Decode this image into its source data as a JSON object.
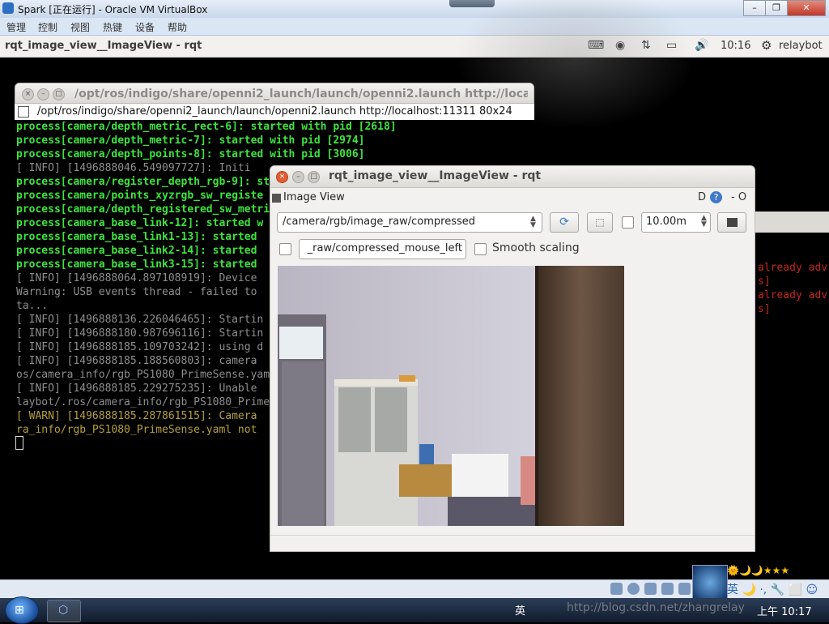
{
  "vbox": {
    "window_title": "Spark [正在运行] - Oracle VM VirtualBox",
    "menu": [
      "管理",
      "控制",
      "视图",
      "热键",
      "设备",
      "帮助"
    ],
    "controls": {
      "minimize": "–",
      "maximize": "❐",
      "close": "✕"
    }
  },
  "ubuntu_panel": {
    "app_title": "rqt_image_view__ImageView - rqt",
    "time": "10:16",
    "user": "relaybot",
    "icons": [
      "keyboard-icon",
      "chrome-icon",
      "network-updown-icon",
      "battery-icon",
      "volume-icon",
      "gear-icon"
    ]
  },
  "terminal": {
    "window_title": "/opt/ros/indigo/share/openni2_launch/launch/openni2.launch http://localhost:",
    "tab_label": "/opt/ros/indigo/share/openni2_launch/launch/openni2.launch http://localhost:11311 80x24",
    "lines": [
      {
        "text": "process[camera/depth_metric_rect-6]: started with pid [2618]",
        "style": "green"
      },
      {
        "text": "process[camera/depth_metric-7]: started with pid [2974]",
        "style": "green"
      },
      {
        "text": "process[camera/depth_points-8]: started with pid [3006]",
        "style": "green"
      },
      {
        "text": "[ INFO] [1496888046.549097727]: Initi",
        "style": "dim"
      },
      {
        "text": "process[camera/register_depth_rgb-9]: st",
        "style": "green"
      },
      {
        "text": "process[camera/points_xyzrgb_sw_registe",
        "style": "green"
      },
      {
        "text": "process[camera/depth_registered_sw_metri",
        "style": "green"
      },
      {
        "text": "process[camera_base_link-12]: started w",
        "style": "green"
      },
      {
        "text": "process[camera_base_link1-13]: started",
        "style": "green"
      },
      {
        "text": "process[camera_base_link2-14]: started",
        "style": "green"
      },
      {
        "text": "process[camera_base_link3-15]: started",
        "style": "green"
      },
      {
        "text": "[ INFO] [1496888064.897108919]: Device",
        "style": "dim"
      },
      {
        "text": "Warning: USB events thread - failed to",
        "style": "dim"
      },
      {
        "text": "ta...",
        "style": "dim"
      },
      {
        "text": "[ INFO] [1496888136.226046465]: Startin",
        "style": "dim"
      },
      {
        "text": "[ INFO] [1496888180.987696116]: Startin",
        "style": "dim"
      },
      {
        "text": "[ INFO] [1496888185.109703242]: using d",
        "style": "dim"
      },
      {
        "text": "[ INFO] [1496888185.188560803]: camera",
        "style": "dim"
      },
      {
        "text": "os/camera_info/rgb_PS1080_PrimeSense.yam",
        "style": "dim"
      },
      {
        "text": "[ INFO] [1496888185.229275235]: Unable",
        "style": "dim"
      },
      {
        "text": "laybot/.ros/camera_info/rgb_PS1080_Prime",
        "style": "dim"
      },
      {
        "text": "[ WARN] [1496888185.287861515]: Camera",
        "style": "warn"
      },
      {
        "text": "ra_info/rgb_PS1080_PrimeSense.yaml not",
        "style": "warn"
      }
    ]
  },
  "bg_terminal": {
    "lines": [
      "already adv",
      "s]",
      "already adv",
      "s]"
    ]
  },
  "rqt": {
    "window_title": "rqt_image_view__ImageView - rqt",
    "plugin_label": "Image View",
    "plugin_controls": "D",
    "plugin_extra": "- O",
    "topic": "/camera/rgb/image_raw/compressed",
    "spin_value": "10.00m",
    "mouse_topic": "_raw/compressed_mouse_left",
    "smooth_scaling_label": "Smooth scaling",
    "smooth_scaling_checked": false,
    "option_checkbox_checked": false,
    "mouse_checkbox_checked": false
  },
  "ime": {
    "row1": "🌞🌙🌙★★★",
    "row2": "英 🌙 ·, 🔧 ⬜ ☺"
  },
  "taskbar": {
    "lang": "英",
    "tray": "▾ 🛡 🔊",
    "watermark": "http://blog.csdn.net/zhangrelay",
    "clock": "上午 10:17"
  }
}
